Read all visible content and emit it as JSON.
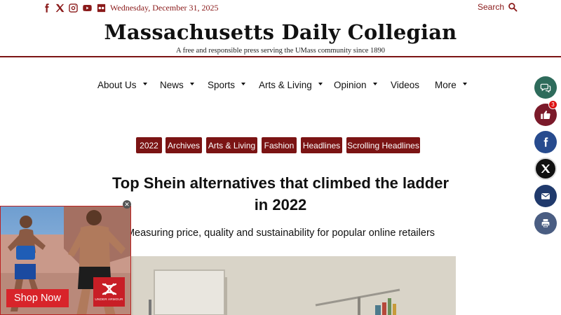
{
  "topbar": {
    "social_icons": [
      "facebook-icon",
      "x-icon",
      "instagram-icon",
      "youtube-icon",
      "flickr-icon"
    ],
    "date": "Wednesday, December 31, 2025",
    "search_label": "Search"
  },
  "masthead": {
    "title": "Massachusetts Daily Collegian",
    "tagline": "A free and responsible press serving the UMass community since 1890"
  },
  "nav": {
    "items": [
      {
        "label": "About Us",
        "has_dropdown": true
      },
      {
        "label": "News",
        "has_dropdown": true
      },
      {
        "label": "Sports",
        "has_dropdown": true
      },
      {
        "label": "Arts & Living",
        "has_dropdown": true
      },
      {
        "label": "Opinion",
        "has_dropdown": true
      },
      {
        "label": "Videos",
        "has_dropdown": false
      },
      {
        "label": "More",
        "has_dropdown": true
      }
    ]
  },
  "tags": [
    "2022",
    "Archives",
    "Arts & Living",
    "Fashion",
    "Headlines",
    "Scrolling Headlines"
  ],
  "article": {
    "headline": "Top Shein alternatives that climbed the ladder in 2022",
    "subhead": "Measuring price, quality and sustainability for popular online retailers"
  },
  "share": {
    "buttons": [
      "comments-icon",
      "like-icon",
      "facebook-icon",
      "x-icon",
      "email-icon",
      "print-icon"
    ],
    "like_count": "3"
  },
  "ad": {
    "cta_label": "Shop Now",
    "brand_text": "UNDER ARMOUR",
    "close_label": "✕"
  },
  "colors": {
    "brand": "#7b1414",
    "share_teal": "#2e6b5b",
    "share_maroon": "#7b1a2a",
    "share_facebook": "#274b8e",
    "share_x": "#111111",
    "share_email": "#203a6c",
    "share_print": "#4a5d82",
    "ad_red": "#d8242a"
  }
}
